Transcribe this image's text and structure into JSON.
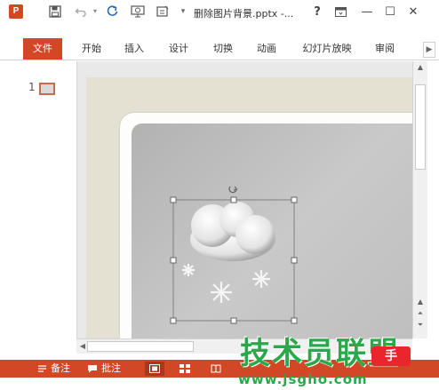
{
  "window": {
    "app_icon_letter": "P",
    "title": "删除图片背景.pptx -...",
    "help_label": "?",
    "min_label": "—",
    "max_label": "☐",
    "close_label": "✕"
  },
  "quick_access": {
    "icons": [
      "save-icon",
      "undo-icon",
      "redo-icon",
      "from-beginning-icon",
      "touch-mode-icon",
      "customize-icon"
    ]
  },
  "ribbon": {
    "tabs": [
      "文件",
      "开始",
      "插入",
      "设计",
      "切换",
      "动画",
      "幻灯片放映",
      "审阅"
    ],
    "active_tab": "文件"
  },
  "slides_pane": {
    "slide_number": "1"
  },
  "status_bar": {
    "notes_label": "备注",
    "comments_label": "批注"
  },
  "watermark": {
    "main_text": "技术员联盟",
    "badge_text": "手",
    "url": "www.jsgho.com"
  },
  "colors": {
    "accent": "#d24726",
    "watermark_green": "#2aa84a",
    "watermark_red": "#e8262b"
  }
}
